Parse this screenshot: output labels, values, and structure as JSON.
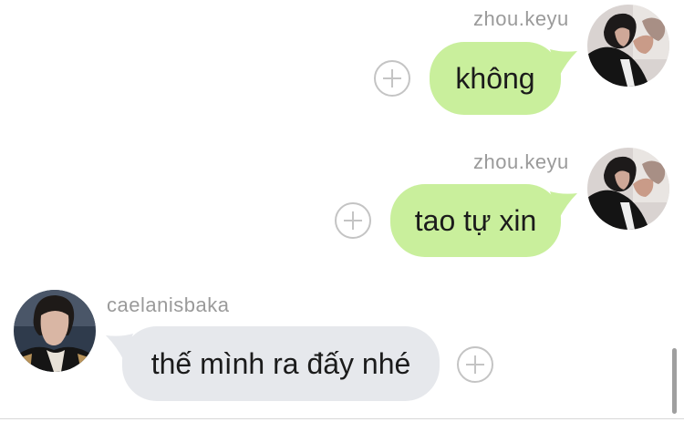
{
  "messages": [
    {
      "username": "zhou.keyu",
      "text": "không",
      "direction": "outgoing",
      "add_reaction_icon": "plus-circle-icon",
      "avatar_icon": "user-avatar-photo"
    },
    {
      "username": "zhou.keyu",
      "text": "tao tự xin",
      "direction": "outgoing",
      "add_reaction_icon": "plus-circle-icon",
      "avatar_icon": "user-avatar-photo"
    },
    {
      "username": "caelanisbaka",
      "text": "thế mình ra đấy nhé",
      "direction": "incoming",
      "add_reaction_icon": "plus-circle-icon",
      "avatar_icon": "user-avatar-photo"
    }
  ],
  "colors": {
    "outgoing_bubble": "#c9ef9c",
    "incoming_bubble": "#e6e8ec",
    "username_text": "#9a9a9a",
    "message_text": "#1b1b1b",
    "plus_icon": "#c4c4c4",
    "background": "#ffffff"
  }
}
